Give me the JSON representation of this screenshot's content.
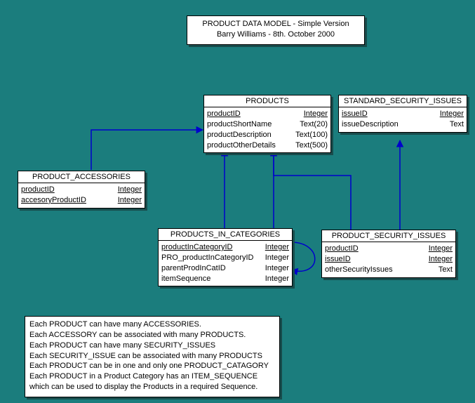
{
  "title": {
    "line1": "PRODUCT DATA MODEL - Simple Version",
    "line2": "Barry Williams - 8th. October 2000"
  },
  "entities": {
    "products": {
      "name": "PRODUCTS",
      "fields": [
        {
          "name": "productID",
          "type": "Integer",
          "pk": true
        },
        {
          "name": "productShortName",
          "type": "Text(20)",
          "pk": false
        },
        {
          "name": "productDescription",
          "type": "Text(100)",
          "pk": false
        },
        {
          "name": "productOtherDetails",
          "type": "Text(500)",
          "pk": false
        }
      ]
    },
    "standard_security_issues": {
      "name": "STANDARD_SECURITY_ISSUES",
      "fields": [
        {
          "name": "issueID",
          "type": "Integer",
          "pk": true
        },
        {
          "name": "issueDescription",
          "type": "Text",
          "pk": false
        }
      ]
    },
    "product_accessories": {
      "name": "PRODUCT_ACCESSORIES",
      "fields": [
        {
          "name": "productID",
          "type": "Integer",
          "pk": true
        },
        {
          "name": "accesoryProductID",
          "type": "Integer",
          "pk": true
        }
      ]
    },
    "products_in_categories": {
      "name": "PRODUCTS_IN_CATEGORIES",
      "fields": [
        {
          "name": "productInCategoryID",
          "type": "Integer",
          "pk": true
        },
        {
          "name": "PRO_productInCategoryID",
          "type": "Integer",
          "pk": false
        },
        {
          "name": "parentProdInCatID",
          "type": "Integer",
          "pk": false
        },
        {
          "name": "itemSequence",
          "type": "Integer",
          "pk": false
        }
      ]
    },
    "product_security_issues": {
      "name": "PRODUCT_SECURITY_ISSUES",
      "fields": [
        {
          "name": "productID",
          "type": "Integer",
          "pk": true
        },
        {
          "name": "issueID",
          "type": "Integer",
          "pk": true
        },
        {
          "name": "otherSecurityIssues",
          "type": "Text",
          "pk": false
        }
      ]
    }
  },
  "notes": [
    "Each PRODUCT can have many ACCESSORIES.",
    "Each ACCESSORY can be associated with many PRODUCTS.",
    "Each PRODUCT can have many SECURITY_ISSUES",
    "Each SECURITY_ISSUE can be associated with many PRODUCTS",
    "Each PRODUCT can be in one and only one PRODUCT_CATAGORY",
    "Each PRODUCT in a Product Category has an ITEM_SEQUENCE",
    "which can be used to display the Products in a required Sequence."
  ],
  "relationships": [
    {
      "from": "PRODUCT_ACCESSORIES",
      "to": "PRODUCTS"
    },
    {
      "from": "PRODUCTS_IN_CATEGORIES",
      "to": "PRODUCTS"
    },
    {
      "from": "PRODUCTS_IN_CATEGORIES",
      "to": "PRODUCTS_IN_CATEGORIES"
    },
    {
      "from": "PRODUCT_SECURITY_ISSUES",
      "to": "PRODUCTS"
    },
    {
      "from": "PRODUCT_SECURITY_ISSUES",
      "to": "STANDARD_SECURITY_ISSUES"
    }
  ]
}
